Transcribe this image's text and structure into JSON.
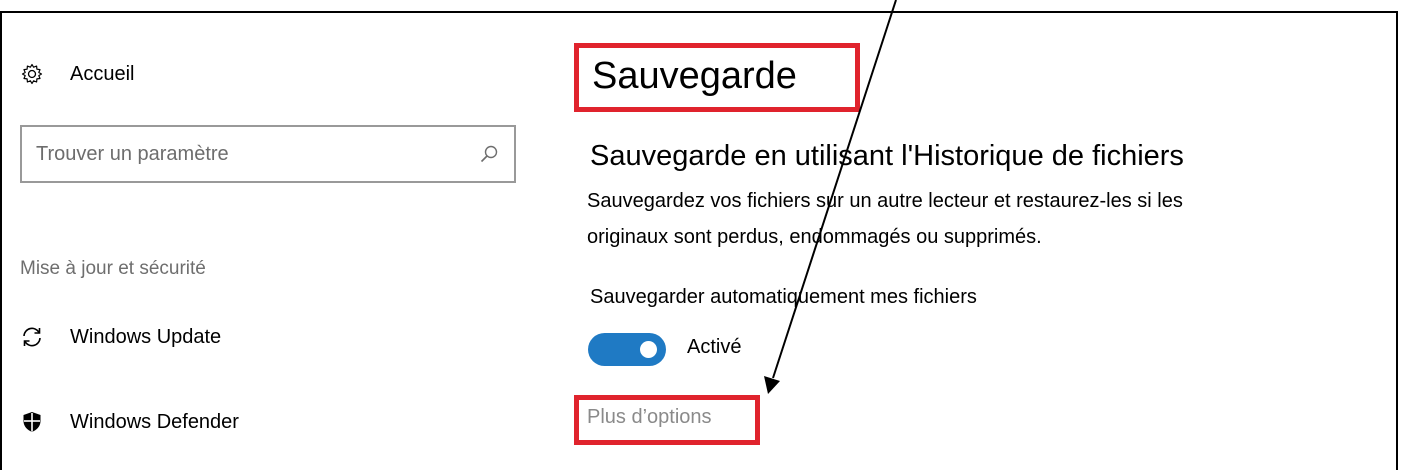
{
  "sidebar": {
    "home": {
      "label": "Accueil",
      "icon": "gear-icon"
    },
    "search": {
      "placeholder": "Trouver un paramètre",
      "icon": "search-icon"
    },
    "section_title": "Mise à jour et sécurité",
    "items": [
      {
        "label": "Windows Update",
        "icon": "refresh-icon"
      },
      {
        "label": "Windows Defender",
        "icon": "shield-icon"
      }
    ]
  },
  "main": {
    "title": "Sauvegarde",
    "subheading": "Sauvegarde en utilisant l'Historique de fichiers",
    "description_line1": "Sauvegardez vos fichiers sur un autre lecteur et restaurez-les si les",
    "description_line2": "originaux sont perdus, endommagés ou supprimés.",
    "auto_backup_label": "Sauvegarder automatiquement mes fichiers",
    "toggle_state": "Activé",
    "more_options_link": "Plus d’options"
  },
  "colors": {
    "highlight": "#e0232d",
    "toggle_on": "#1f7ac4",
    "secondary_text": "#6e6e6e"
  }
}
